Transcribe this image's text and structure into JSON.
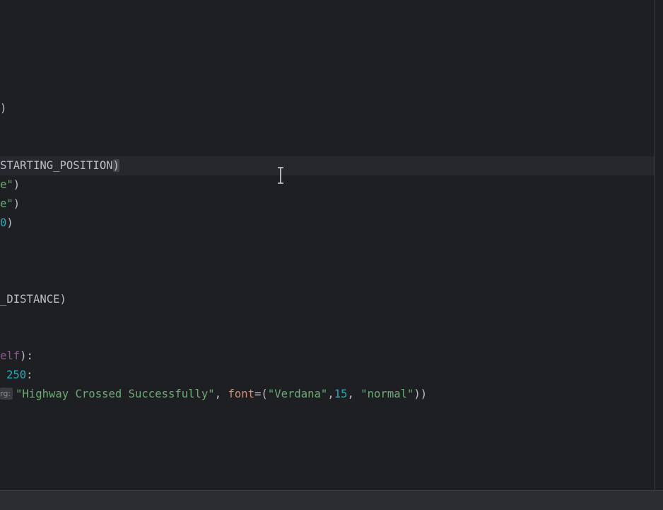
{
  "editor": {
    "lines": {
      "l1": {
        "paren": ")"
      },
      "l2": {
        "ident": "STARTING_POSITION",
        "paren": ")"
      },
      "l3": {
        "str": "e\"",
        "paren": ")"
      },
      "l4": {
        "str": "e\"",
        "paren": ")"
      },
      "l5": {
        "num": "0",
        "paren": ")"
      },
      "l6": {
        "text": "_DISTANCE)"
      },
      "l7": {
        "self": "elf",
        "rest": "):"
      },
      "l8": {
        "num": "250",
        "rest": ":"
      },
      "l9": {
        "hint": "rg:",
        "str1": "\"Highway Crossed Successfully\"",
        "comma1": ", ",
        "kwarg": "font",
        "eq": "=(",
        "str2": "\"Verdana\"",
        "comma2": ",",
        "num": "15",
        "comma3": ", ",
        "str3": "\"normal\"",
        "close": "))"
      }
    }
  }
}
